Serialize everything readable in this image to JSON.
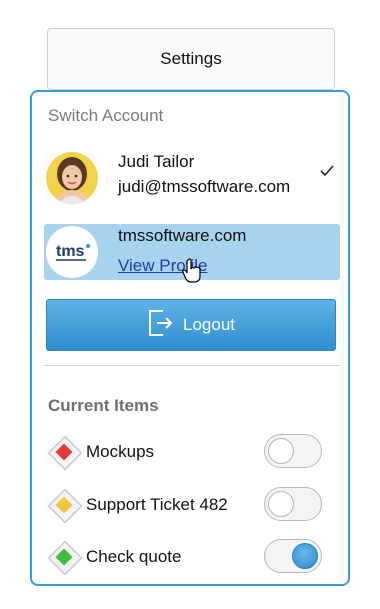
{
  "settings_button": {
    "label": "Settings"
  },
  "switch_account": {
    "title": "Switch Account",
    "accounts": [
      {
        "name": "Judi Tailor",
        "email": "judi@tmssoftware.com",
        "selected": true
      },
      {
        "name": "tmssoftware.com",
        "link": "View Profile",
        "logo_text": "tms"
      }
    ]
  },
  "logout": {
    "label": "Logout"
  },
  "current_items": {
    "title": "Current Items",
    "items": [
      {
        "label": "Mockups",
        "color": "#e53935",
        "toggle": false
      },
      {
        "label": "Support Ticket 482",
        "color": "#f5c542",
        "toggle": false
      },
      {
        "label": "Check quote",
        "color": "#3fbf3f",
        "toggle": true
      }
    ]
  },
  "colors": {
    "accent": "#3a9be0",
    "highlight": "#a7d3ef"
  },
  "icons": {
    "check": "checkmark-icon",
    "logout": "logout-icon",
    "cursor": "hand-cursor-icon"
  }
}
